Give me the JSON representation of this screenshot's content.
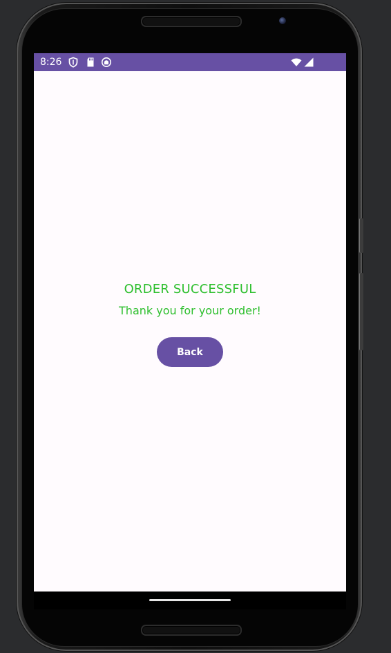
{
  "status_bar": {
    "time": "8:26",
    "icons": [
      "shield-icon",
      "sd-card-icon",
      "app-notification-icon",
      "wifi-icon",
      "cellular-signal-icon"
    ],
    "background_color": "#6750a4"
  },
  "order": {
    "title": "ORDER SUCCESSFUL",
    "message": "Thank you for your order!",
    "text_color": "#2ebf2e"
  },
  "actions": {
    "back_label": "Back",
    "button_color": "#6750a4"
  },
  "navigation": {
    "home_indicator": "gesture-bar"
  }
}
